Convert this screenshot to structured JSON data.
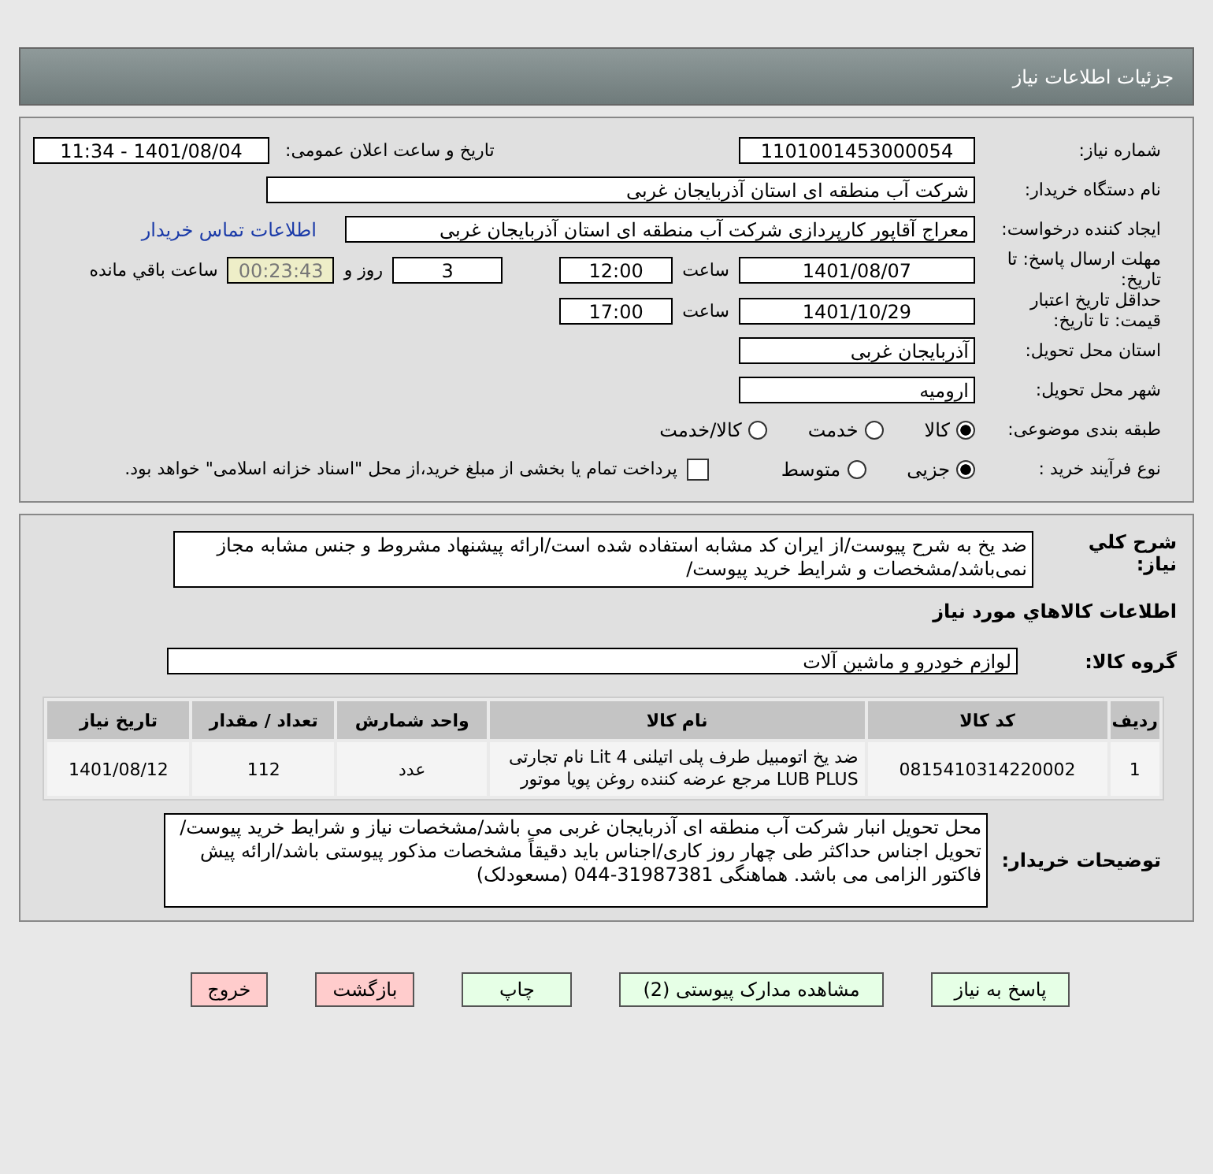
{
  "header": {
    "title": "جزئیات اطلاعات نیاز"
  },
  "need_number": {
    "label": "شماره نیاز:",
    "value": "1101001453000054"
  },
  "announce": {
    "label": "تاریخ و ساعت اعلان عمومی:",
    "value": "1401/08/04 - 11:34"
  },
  "buyer_org": {
    "label": "نام دستگاه خریدار:",
    "value": "شرکت آب منطقه ای استان آذربایجان غربی"
  },
  "requester": {
    "label": "ایجاد کننده درخواست:",
    "value": "معراج آقاپور کارپردازی شرکت آب منطقه ای استان آذربایجان غربی",
    "link": "اطلاعات تماس خریدار"
  },
  "deadline": {
    "label": "مهلت ارسال پاسخ: تا تاریخ:",
    "date": "1401/08/07",
    "time_label": "ساعت",
    "time": "12:00",
    "days": "3",
    "days_label": "روز و",
    "remaining": "00:23:43",
    "remaining_label": "ساعت باقي مانده"
  },
  "validity": {
    "label": "حداقل تاریخ اعتبار قیمت: تا تاریخ:",
    "date": "1401/10/29",
    "time_label": "ساعت",
    "time": "17:00"
  },
  "province": {
    "label": "استان محل تحویل:",
    "value": "آذربایجان غربی"
  },
  "city": {
    "label": "شهر محل تحویل:",
    "value": "ارومیه"
  },
  "category": {
    "label": "طبقه بندی موضوعی:",
    "options": [
      {
        "label": "کالا",
        "selected": true
      },
      {
        "label": "خدمت",
        "selected": false
      },
      {
        "label": "کالا/خدمت",
        "selected": false
      }
    ]
  },
  "process": {
    "label": "نوع فرآیند خرید :",
    "options": [
      {
        "label": "جزیی",
        "selected": true
      },
      {
        "label": "متوسط",
        "selected": false
      }
    ],
    "payment": {
      "checked": false,
      "text": "پرداخت تمام یا بخشی از مبلغ خرید،از محل \"اسناد خزانه اسلامی\" خواهد بود."
    }
  },
  "description": {
    "label": "شرح کلي نياز:",
    "value": "ضد یخ به شرح پیوست/از ایران کد مشابه استفاده شده است/ارائه پیشنهاد مشروط و جنس مشابه مجاز نمی‌باشد/مشخصات و شرایط خرید پیوست/"
  },
  "goods_title": "اطلاعات کالاهاي مورد نياز",
  "goods_group": {
    "label": "گروه کالا:",
    "value": "لوازم خودرو و ماشین آلات"
  },
  "table": {
    "columns": [
      "ردیف",
      "کد کالا",
      "نام کالا",
      "واحد شمارش",
      "تعداد / مقدار",
      "تاریخ نیاز"
    ],
    "rows": [
      [
        "1",
        "0815410314220002",
        "ضد یخ اتومبیل طرف پلی اتیلنی 4 Lit نام تجارتی LUB PLUS مرجع عرضه کننده روغن پویا موتور",
        "عدد",
        "112",
        "1401/08/12"
      ]
    ]
  },
  "buyer_notes": {
    "label": "توضیحات خریدار:",
    "value": "محل تحویل انبار شرکت آب منطقه ای آذربایجان غربی می باشد/مشخصات نیاز و شرایط خرید پیوست/تحویل اجناس حداکثر طی چهار روز کاری/اجناس باید دقیقاً مشخصات مذکور پیوستی باشد/ارائه پیش فاکتور الزامی می باشد. هماهنگی 31987381-044 (مسعودلک)"
  },
  "buttons": [
    {
      "label": "پاسخ به نیاز",
      "kind": "action"
    },
    {
      "label": "مشاهده مدارک پیوستی (2)",
      "kind": "action"
    },
    {
      "label": "چاپ",
      "kind": "action"
    },
    {
      "label": "بازگشت",
      "kind": "exit"
    },
    {
      "label": "خروج",
      "kind": "exit"
    }
  ]
}
